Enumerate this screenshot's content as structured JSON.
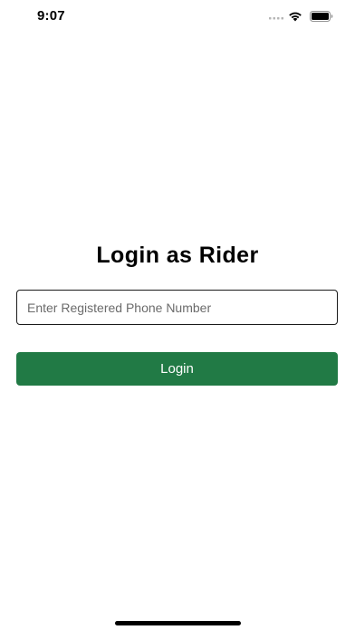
{
  "status_bar": {
    "time": "9:07",
    "icons": [
      "signal-icon",
      "wifi-icon",
      "battery-icon"
    ]
  },
  "login": {
    "title": "Login as Rider",
    "phone_placeholder": "Enter Registered Phone Number",
    "phone_value": "",
    "button_label": "Login"
  },
  "colors": {
    "primary_button": "#217a45",
    "button_text": "#ffffff",
    "background": "#ffffff"
  }
}
